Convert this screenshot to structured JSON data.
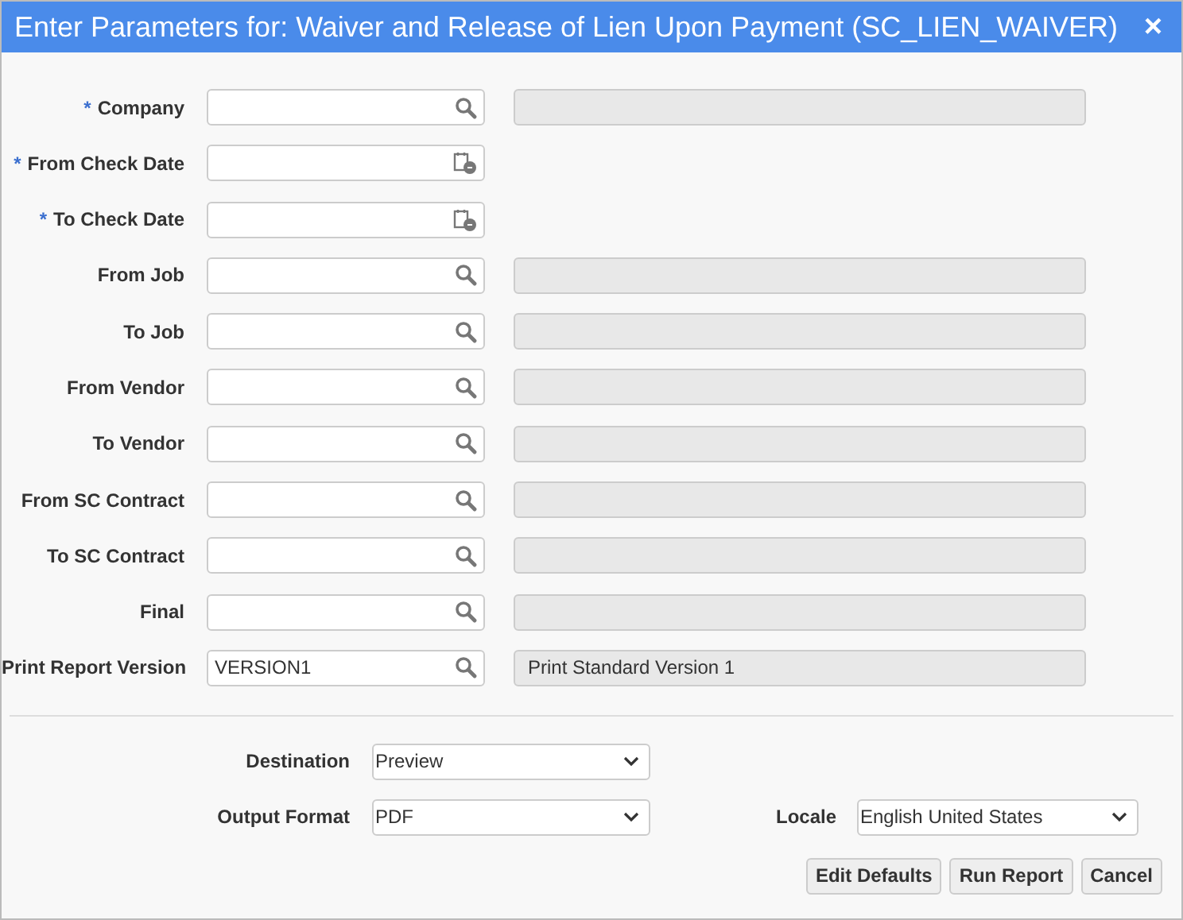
{
  "window": {
    "title": "Enter Parameters for: Waiver and Release of Lien Upon Payment (SC_LIEN_WAIVER)",
    "close": "×"
  },
  "parameters": [
    {
      "mark": "*",
      "label": "Company",
      "kind": "lookup"
    },
    {
      "mark": "*",
      "label": "From Check Date",
      "kind": "date"
    },
    {
      "mark": "*",
      "label": "To Check Date",
      "kind": "date"
    },
    {
      "label": "From Job",
      "kind": "lookup"
    },
    {
      "label": "To Job",
      "kind": "lookup"
    },
    {
      "label": "From Vendor",
      "kind": "lookup"
    },
    {
      "label": "To Vendor",
      "kind": "lookup"
    },
    {
      "label": "From SC Contract",
      "kind": "lookup"
    },
    {
      "label": "To SC Contract",
      "kind": "lookup"
    },
    {
      "label": "Final",
      "kind": "lookup"
    },
    {
      "label": "Print Report Version",
      "kind": "lookup",
      "value": "VERSION1",
      "description": "Print Standard Version 1"
    }
  ],
  "destination": {
    "label": "Destination",
    "value": "Preview"
  },
  "output_format": {
    "label": "Output Format",
    "value": "PDF"
  },
  "locale": {
    "label": "Locale",
    "value": "English United States"
  },
  "buttons": [
    "Edit Defaults",
    "Run Report",
    "Cancel"
  ]
}
